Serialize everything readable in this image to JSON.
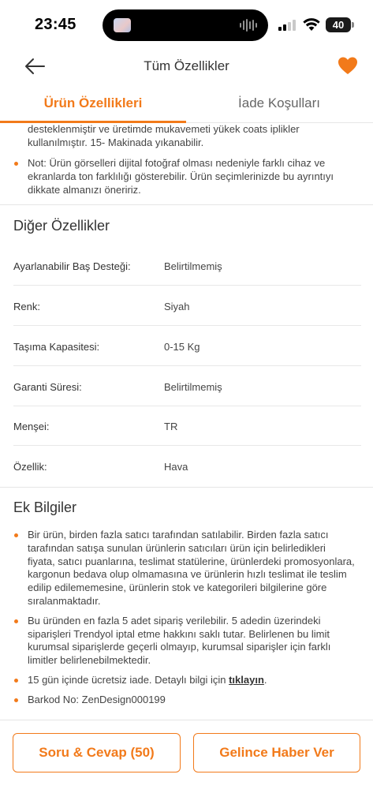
{
  "status_bar": {
    "time": "23:45",
    "battery": "40"
  },
  "header": {
    "title": "Tüm Özellikler"
  },
  "tabs": [
    {
      "label": "Ürün Özellikleri",
      "active": true
    },
    {
      "label": "İade Koşulları",
      "active": false
    }
  ],
  "description": {
    "partial_text": "desteklenmiştir ve üretimde mukavemeti yükek coats iplikler kullanılmıştır. 15- Makinada yıkanabilir.",
    "note_text": "Not: Ürün görselleri dijital fotoğraf olması nedeniyle farklı cihaz ve ekranlarda ton farklılığı gösterebilir. Ürün seçimlerinizde bu ayrıntıyı dikkate almanızı öneririz."
  },
  "other_features": {
    "title": "Diğer Özellikler",
    "rows": [
      {
        "label": "Ayarlanabilir Baş Desteği:",
        "value": "Belirtilmemiş"
      },
      {
        "label": "Renk:",
        "value": "Siyah"
      },
      {
        "label": "Taşıma Kapasitesi:",
        "value": "0-15 Kg"
      },
      {
        "label": "Garanti Süresi:",
        "value": "Belirtilmemiş"
      },
      {
        "label": "Menşei:",
        "value": "TR"
      },
      {
        "label": "Özellik:",
        "value": "Hava"
      }
    ]
  },
  "extra_info": {
    "title": "Ek Bilgiler",
    "items": [
      "Bir ürün, birden fazla satıcı tarafından satılabilir. Birden fazla satıcı tarafından satışa sunulan ürünlerin satıcıları ürün için belirledikleri fiyata, satıcı puanlarına, teslimat statülerine, ürünlerdeki promosyonlara, kargonun bedava olup olmamasına ve ürünlerin hızlı teslimat ile teslim edilip edilememesine, ürünlerin stok ve kategorileri bilgilerine göre sıralanmaktadır.",
      "Bu üründen en fazla 5 adet sipariş verilebilir. 5 adedin üzerindeki siparişleri Trendyol iptal etme hakkını saklı tutar. Belirlenen bu limit kurumsal siparişlerde geçerli olmayıp, kurumsal siparişler için farklı limitler belirlenebilmektedir.",
      "Barkod No: ZenDesign000199"
    ],
    "return_prefix": "15 gün içinde ücretsiz iade. Detaylı bilgi için ",
    "return_link": "tıklayın",
    "return_suffix": "."
  },
  "bottom": {
    "qa_button": "Soru & Cevap (50)",
    "notify_button": "Gelince Haber Ver"
  },
  "colors": {
    "accent": "#f27a1a"
  }
}
